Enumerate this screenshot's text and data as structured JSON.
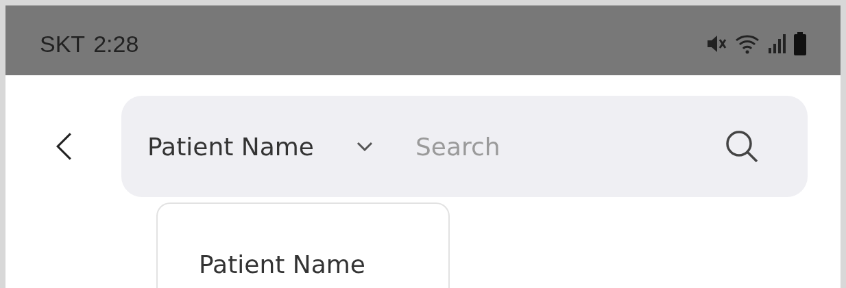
{
  "status_bar": {
    "carrier": "SKT",
    "time": "2:28"
  },
  "search_bar": {
    "field_selector": {
      "label": "Patient Name",
      "expanded": true
    },
    "placeholder": "Search"
  },
  "dropdown": {
    "options": [
      {
        "label": "Patient Name"
      }
    ]
  }
}
